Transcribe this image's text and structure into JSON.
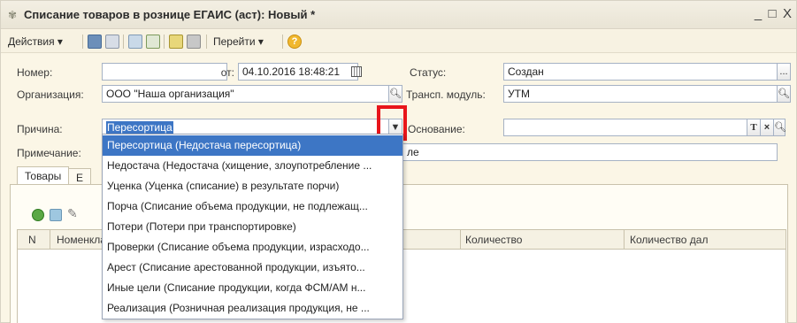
{
  "window": {
    "title": "Списание товаров в рознице ЕГАИС (аст): Новый *",
    "minimize": "_",
    "maximize": "□",
    "close": "X"
  },
  "toolbar": {
    "actions_label": "Действия",
    "goto_label": "Перейти",
    "help_label": "?"
  },
  "form": {
    "number_label": "Номер:",
    "number_value": "",
    "from_label": "от:",
    "date_value": "04.10.2016 18:48:21",
    "status_label": "Статус:",
    "status_value": "Создан",
    "status_btn": "...",
    "org_label": "Организация:",
    "org_value": "ООО \"Наша организация\"",
    "transport_label": "Трансп. модуль:",
    "transport_value": "УТМ",
    "reason_label": "Причина:",
    "reason_value": "Пересортица",
    "basis_label": "Основание:",
    "basis_value": "",
    "basis_t": "T",
    "basis_x": "×",
    "note_label": "Примечание:",
    "note_value_tail": "ле"
  },
  "tabs": [
    {
      "label": "Товары"
    },
    {
      "label": "Е"
    }
  ],
  "grid": {
    "columns": [
      "N",
      "Номенклатура",
      "Количество",
      "Количество дал"
    ]
  },
  "dropdown": {
    "options": [
      "Пересортица (Недостача пересортица)",
      "Недостача (Недостача (хищение, злоупотребление ...",
      "Уценка (Уценка (списание) в результате порчи)",
      "Порча (Списание объема продукции, не подлежащ...",
      "Потери (Потери при транспортировке)",
      "Проверки (Списание объема продукции, израсходо...",
      "Арест (Списание арестованной продукции, изъято...",
      "Иные цели (Списание продукции, когда ФСМ/АМ н...",
      "Реализация (Розничная реализация продукция, не ..."
    ],
    "selected_index": 0
  },
  "colors": {
    "accent": "#3d76c5",
    "highlight": "#e8151b",
    "background": "#fbf6e6"
  }
}
